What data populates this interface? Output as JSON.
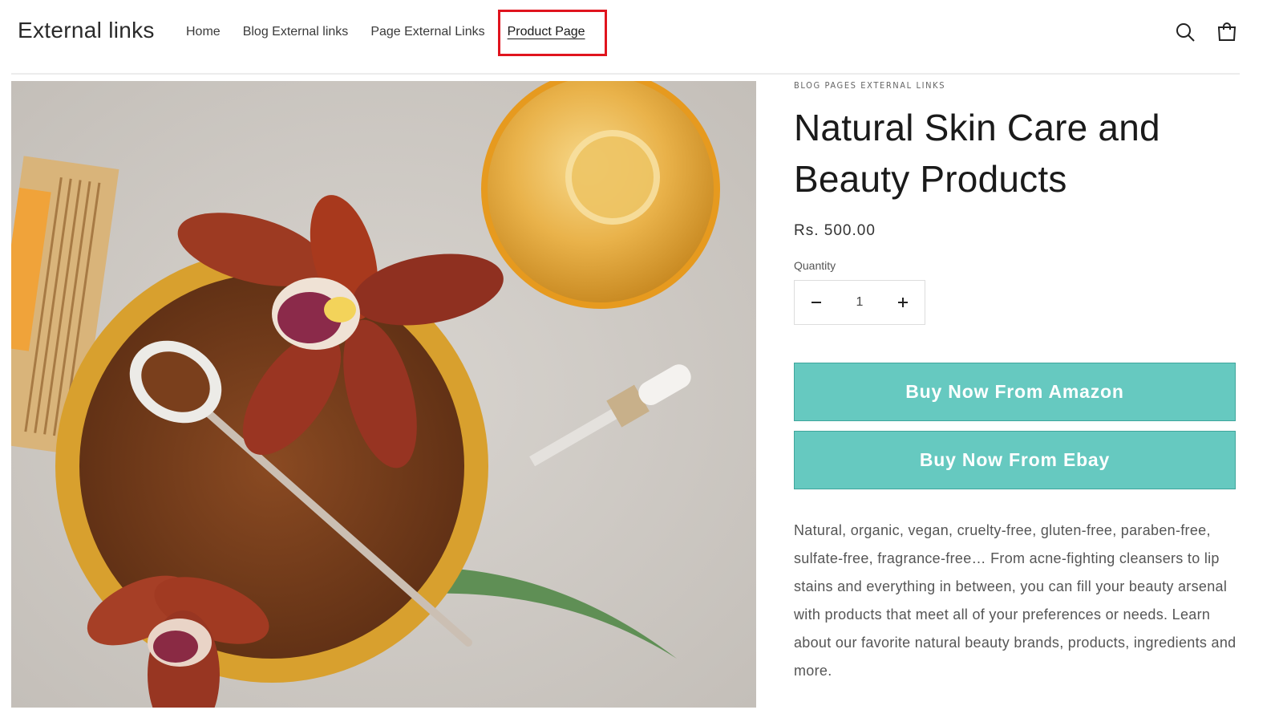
{
  "header": {
    "logo": "External links",
    "nav": [
      {
        "label": "Home",
        "active": false
      },
      {
        "label": "Blog External links",
        "active": false
      },
      {
        "label": "Page External Links",
        "active": false
      },
      {
        "label": "Product Page",
        "active": true
      }
    ],
    "icons": [
      "search-icon",
      "cart-icon"
    ]
  },
  "product": {
    "vendor": "BLOG PAGES EXTERNAL LINKS",
    "title": "Natural Skin Care and Beauty Products",
    "price": "Rs. 500.00",
    "quantity_label": "Quantity",
    "quantity_value": "1",
    "buy_amazon_label": "Buy Now From Amazon",
    "buy_ebay_label": "Buy Now From Ebay",
    "description": "Natural, organic, vegan, cruelty-free, gluten-free, paraben-free, sulfate-free, fragrance-free… From acne-fighting cleansers to lip stains and everything in between, you can fill your beauty arsenal with products that meet all of your preferences or needs. Learn about our favorite natural beauty brands, products, ingredients and more."
  },
  "colors": {
    "button_bg": "#66c9c0",
    "highlight": "#e0141e"
  }
}
